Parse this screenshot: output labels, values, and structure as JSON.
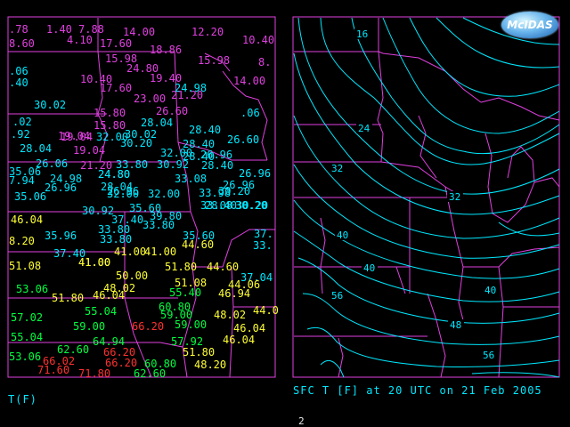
{
  "left_panel": {
    "caption": "T(F)",
    "observations": [
      {
        "text": ".78",
        "c": "#e040e0"
      },
      {
        "text": "1.40",
        "c": "#e040e0"
      },
      {
        "text": "7.88",
        "c": "#e040e0"
      },
      {
        "text": "14.00",
        "c": "#e040e0"
      },
      {
        "text": "12.20",
        "c": "#e040e0"
      },
      {
        "text": "8.60",
        "c": "#e040e0"
      },
      {
        "text": "4.10",
        "c": "#e040e0"
      },
      {
        "text": "17.60",
        "c": "#e040e0"
      },
      {
        "text": "10.40",
        "c": "#e040e0"
      },
      {
        "text": "15.98",
        "c": "#e040e0"
      },
      {
        "text": "18.86",
        "c": "#e040e0"
      },
      {
        "text": "8.",
        "c": "#e040e0"
      },
      {
        "text": "24.80",
        "c": "#e040e0"
      },
      {
        "text": "15.98",
        "c": "#e040e0"
      },
      {
        "text": ".06",
        "c": "#00e8ff"
      },
      {
        "text": "10.40",
        "c": "#e040e0"
      },
      {
        "text": "19.40",
        "c": "#e040e0"
      },
      {
        "text": ".40",
        "c": "#00e8ff"
      },
      {
        "text": "17.60",
        "c": "#e040e0"
      },
      {
        "text": "24.98",
        "c": "#00e8ff"
      },
      {
        "text": "14.00",
        "c": "#e040e0"
      },
      {
        "text": "23.00",
        "c": "#e040e0"
      },
      {
        "text": "21.20",
        "c": "#e040e0"
      },
      {
        "text": "30.02",
        "c": "#00e8ff"
      },
      {
        "text": "15.80",
        "c": "#e040e0"
      },
      {
        "text": "26.60",
        "c": "#e040e0"
      },
      {
        "text": ".06",
        "c": "#00e8ff"
      },
      {
        "text": "15.80",
        "c": "#e040e0"
      },
      {
        "text": "28.04",
        "c": "#00e8ff"
      },
      {
        "text": ".02",
        "c": "#00e8ff"
      },
      {
        "text": "19.04",
        "c": "#e040e0"
      },
      {
        "text": "30.02",
        "c": "#00e8ff"
      },
      {
        "text": "28.40",
        "c": "#00e8ff"
      },
      {
        "text": ".92",
        "c": "#00e8ff"
      },
      {
        "text": "19.04",
        "c": "#e040e0"
      },
      {
        "text": "32.00",
        "c": "#00e8ff"
      },
      {
        "text": "26.60",
        "c": "#00e8ff"
      },
      {
        "text": "28.04",
        "c": "#00e8ff"
      },
      {
        "text": "30.20",
        "c": "#00e8ff"
      },
      {
        "text": "28.40",
        "c": "#00e8ff"
      },
      {
        "text": "24.80",
        "c": "#00e8ff"
      },
      {
        "text": "19.04",
        "c": "#e040e0"
      },
      {
        "text": "32.00",
        "c": "#00e8ff"
      },
      {
        "text": "28.40",
        "c": "#00e8ff"
      },
      {
        "text": "26.96",
        "c": "#00e8ff"
      },
      {
        "text": "26.06",
        "c": "#00e8ff"
      },
      {
        "text": "21.20",
        "c": "#e040e0"
      },
      {
        "text": "33.80",
        "c": "#00e8ff"
      },
      {
        "text": "30.92",
        "c": "#00e8ff"
      },
      {
        "text": "28.40",
        "c": "#00e8ff"
      },
      {
        "text": "35.06",
        "c": "#00e8ff"
      },
      {
        "text": "24.80",
        "c": "#00e8ff"
      },
      {
        "text": "33.08",
        "c": "#00e8ff"
      },
      {
        "text": "26.96",
        "c": "#00e8ff"
      },
      {
        "text": "7.94",
        "c": "#00e8ff"
      },
      {
        "text": "24.98",
        "c": "#00e8ff"
      },
      {
        "text": "28.04",
        "c": "#00e8ff"
      },
      {
        "text": "26.96",
        "c": "#00e8ff"
      },
      {
        "text": "26.96",
        "c": "#00e8ff"
      },
      {
        "text": "35.06",
        "c": "#00e8ff"
      },
      {
        "text": "26.96",
        "c": "#00e8ff"
      },
      {
        "text": "32.00",
        "c": "#00e8ff"
      },
      {
        "text": "33.98",
        "c": "#00e8ff"
      },
      {
        "text": "30.20",
        "c": "#00e8ff"
      },
      {
        "text": "30.20",
        "c": "#00e8ff"
      },
      {
        "text": "28.40",
        "c": "#00e8ff"
      },
      {
        "text": "35.60",
        "c": "#00e8ff"
      },
      {
        "text": "33.08",
        "c": "#00e8ff"
      },
      {
        "text": "30.20",
        "c": "#00e8ff"
      },
      {
        "text": "30.92",
        "c": "#00e8ff"
      },
      {
        "text": "37.40",
        "c": "#00e8ff"
      },
      {
        "text": "39.80",
        "c": "#00e8ff"
      },
      {
        "text": "46.04",
        "c": "#ffff33"
      },
      {
        "text": "33.80",
        "c": "#00e8ff"
      },
      {
        "text": "33.80",
        "c": "#00e8ff"
      },
      {
        "text": "32.00",
        "c": "#00e8ff"
      },
      {
        "text": "33.80",
        "c": "#00e8ff"
      },
      {
        "text": "35.96",
        "c": "#00e8ff"
      },
      {
        "text": "35.60",
        "c": "#00e8ff"
      },
      {
        "text": "37.",
        "c": "#00e8ff"
      },
      {
        "text": "8.20",
        "c": "#ffff33"
      },
      {
        "text": "37.40",
        "c": "#00e8ff"
      },
      {
        "text": "44.60",
        "c": "#ffff33"
      },
      {
        "text": "41.00",
        "c": "#ffff33"
      },
      {
        "text": "41.00",
        "c": "#ffff33"
      },
      {
        "text": "41.00",
        "c": "#ffff33"
      },
      {
        "text": "33.",
        "c": "#00e8ff"
      },
      {
        "text": "51.08",
        "c": "#ffff33"
      },
      {
        "text": "41.00",
        "c": "#ffff33"
      },
      {
        "text": "51.80",
        "c": "#ffff33"
      },
      {
        "text": "44.60",
        "c": "#ffff33"
      },
      {
        "text": "50.00",
        "c": "#ffff33"
      },
      {
        "text": "37.04",
        "c": "#00e8ff"
      },
      {
        "text": "53.06",
        "c": "#00ff40"
      },
      {
        "text": "48.02",
        "c": "#ffff33"
      },
      {
        "text": "51.08",
        "c": "#ffff33"
      },
      {
        "text": "44.06",
        "c": "#ffff33"
      },
      {
        "text": "51.80",
        "c": "#ffff33"
      },
      {
        "text": "46.04",
        "c": "#ffff33"
      },
      {
        "text": "55.40",
        "c": "#00ff40"
      },
      {
        "text": "46.94",
        "c": "#ffff33"
      },
      {
        "text": "55.04",
        "c": "#00ff40"
      },
      {
        "text": "60.80",
        "c": "#00ff40"
      },
      {
        "text": "44.0",
        "c": "#ffff33"
      },
      {
        "text": "57.02",
        "c": "#00ff40"
      },
      {
        "text": "59.00",
        "c": "#00ff40"
      },
      {
        "text": "48.02",
        "c": "#ffff33"
      },
      {
        "text": "59.00",
        "c": "#00ff40"
      },
      {
        "text": "66.20",
        "c": "#ff3030"
      },
      {
        "text": "59.00",
        "c": "#00ff40"
      },
      {
        "text": "46.04",
        "c": "#ffff33"
      },
      {
        "text": "55.04",
        "c": "#00ff40"
      },
      {
        "text": "64.94",
        "c": "#00ff40"
      },
      {
        "text": "57.92",
        "c": "#00ff40"
      },
      {
        "text": "46.04",
        "c": "#ffff33"
      },
      {
        "text": "62.60",
        "c": "#00ff40"
      },
      {
        "text": "51.80",
        "c": "#ffff33"
      },
      {
        "text": "53.06",
        "c": "#00ff40"
      },
      {
        "text": "66.20",
        "c": "#ff3030"
      },
      {
        "text": "66.02",
        "c": "#ff3030"
      },
      {
        "text": "60.80",
        "c": "#00ff40"
      },
      {
        "text": "48.20",
        "c": "#ffff33"
      },
      {
        "text": "66.20",
        "c": "#ff3030"
      },
      {
        "text": "71.60",
        "c": "#ff3030"
      },
      {
        "text": "71.80",
        "c": "#ff3030"
      },
      {
        "text": "62.60",
        "c": "#00ff40"
      }
    ]
  },
  "right_panel": {
    "caption": "SFC T [F] at 20 UTC on 21 Feb 2005",
    "logo": "McIDAS",
    "contour_labels": [
      "16",
      "24",
      "32",
      "32",
      "40",
      "40",
      "40",
      "48",
      "56",
      "56"
    ]
  },
  "frame_number": "2",
  "colors": {
    "background": "#000000",
    "map_lines": "#e040e0",
    "contours": "#00e8ff",
    "caption": "#00e8ff"
  }
}
